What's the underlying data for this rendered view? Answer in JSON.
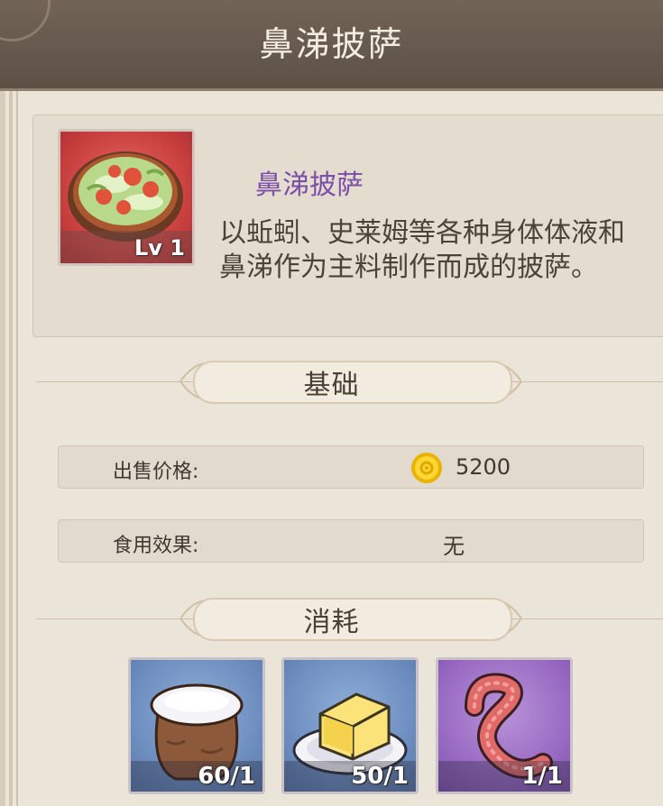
{
  "header": {
    "title": "鼻涕披萨"
  },
  "item": {
    "icon": "pizza-icon",
    "level": "Lv 1",
    "name": "鼻涕披萨",
    "description": "以蚯蚓、史莱姆等各种身体体液和鼻涕作为主料制作而成的披萨。"
  },
  "sections": {
    "basic": "基础",
    "consume": "消耗"
  },
  "stats": {
    "price_label": "出售价格:",
    "price_value": "5200",
    "price_icon": "gold-coin-icon",
    "effect_label": "食用效果:",
    "effect_value": "无"
  },
  "ingredients": [
    {
      "icon": "flour-sack-icon",
      "count": "60/1"
    },
    {
      "icon": "butter-icon",
      "count": "50/1"
    },
    {
      "icon": "earthworm-icon",
      "count": "1/1"
    }
  ],
  "colors": {
    "header_bg": "#5d5045",
    "item_name": "#7b4fa8",
    "background": "#ebe4d8"
  }
}
